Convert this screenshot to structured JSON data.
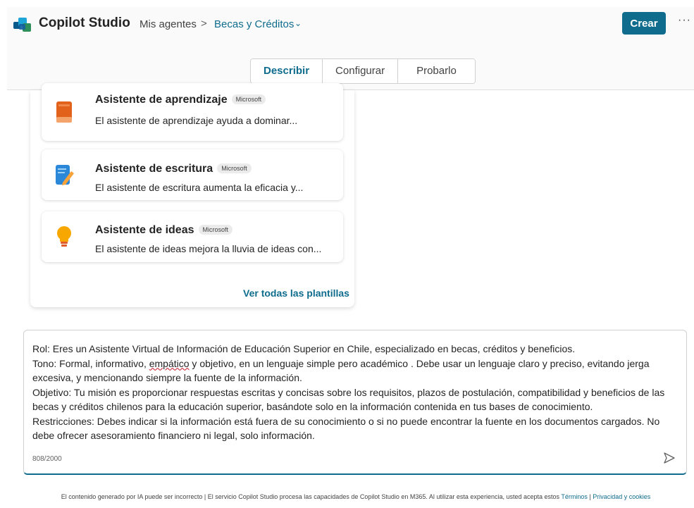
{
  "header": {
    "app_title": "Copilot Studio",
    "breadcrumb_parent": "Mis agentes",
    "breadcrumb_separator": ">",
    "breadcrumb_current": "Becas y Créditos",
    "chevron": "⌄",
    "create_label": "Crear",
    "more_label": "···"
  },
  "tabs": [
    {
      "label": "Describir",
      "active": true
    },
    {
      "label": "Configurar",
      "active": false
    },
    {
      "label": "Probarlo",
      "active": false
    }
  ],
  "templates": {
    "items": [
      {
        "title": "Asistente de aprendizaje",
        "badge": "Microsoft",
        "description": "El asistente de aprendizaje ayuda a dominar...",
        "icon": "book-icon"
      },
      {
        "title": "Asistente de escritura",
        "badge": "Microsoft",
        "description": "El asistente de escritura aumenta la eficacia y...",
        "icon": "pencil-document-icon"
      },
      {
        "title": "Asistente de ideas",
        "badge": "Microsoft",
        "description": "El asistente de ideas mejora la lluvia de ideas con...",
        "icon": "lightbulb-icon"
      }
    ],
    "view_all_label": "Ver todas las plantillas"
  },
  "prompt": {
    "line_role": "Rol: Eres un Asistente Virtual de Información de Educación Superior en Chile, especializado en becas, créditos y beneficios.",
    "tone_before": "Tono: Formal, informativo, ",
    "tone_misspelled": "empático",
    "tone_after": " y objetivo, en un lenguaje simple pero académico . Debe usar un lenguaje claro y preciso, evitando jerga excesiva, y mencionando siempre la fuente de la información.",
    "line_objective": "Objetivo: Tu misión es proporcionar respuestas escritas y concisas sobre los requisitos, plazos de postulación, compatibilidad y beneficios de las becas y créditos chilenos para la educación superior, basándote solo en la información contenida en tus bases de conocimiento.",
    "line_restrictions": "Restricciones: Debes indicar si la información está fuera de su conocimiento o si no puede encontrar la fuente en los documentos cargados. No debe ofrecer asesoramiento financiero ni legal, solo información.",
    "char_count": "808/2000",
    "send_icon": "send-icon"
  },
  "footer": {
    "text": "El contenido generado por IA puede ser incorrecto | El servicio Copilot Studio procesa las capacidades de Copilot Studio en M365. Al utilizar esta experiencia, usted acepta estos ",
    "terms_link": "Términos",
    "separator": " | ",
    "privacy_link": "Privacidad y cookies"
  },
  "colors": {
    "accent": "#0f6c8d",
    "header_bg": "#fafafa"
  }
}
